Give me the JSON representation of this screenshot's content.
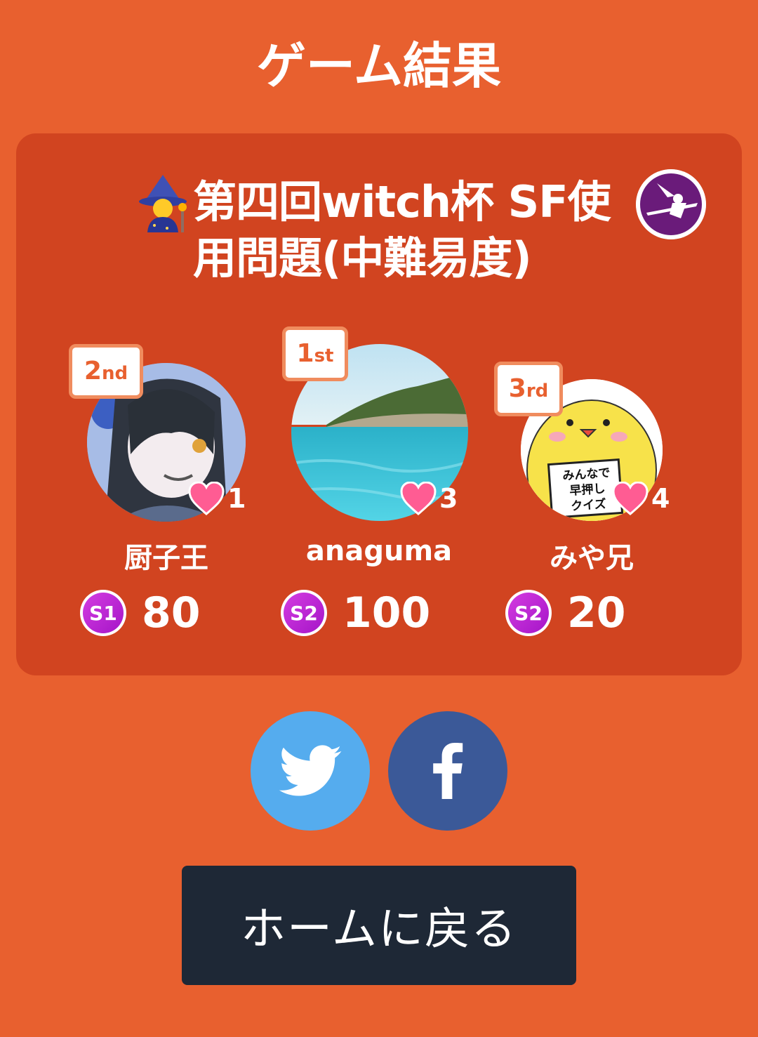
{
  "header": {
    "title": "ゲーム結果"
  },
  "quiz": {
    "emoji_icon": "witch-emoji",
    "title": "第四回witch杯 SF使用問題(中難易度)",
    "owner_avatar_icon": "witch-silhouette-icon"
  },
  "players": [
    {
      "rank_num": "2",
      "rank_suffix": "nd",
      "name": "厨子王",
      "likes": "1",
      "rank_icon": "S1",
      "score": "80"
    },
    {
      "rank_num": "1",
      "rank_suffix": "st",
      "name": "anaguma",
      "likes": "3",
      "rank_icon": "S2",
      "score": "100"
    },
    {
      "rank_num": "3",
      "rank_suffix": "rd",
      "name": "みや兄",
      "likes": "4",
      "rank_icon": "S2",
      "score": "20"
    }
  ],
  "avatar3_sign": [
    "みんなで",
    "早押し",
    "クイズ"
  ],
  "share": {
    "twitter_icon": "twitter-icon",
    "facebook_icon": "facebook-icon"
  },
  "actions": {
    "home_label": "ホームに戻る"
  },
  "colors": {
    "background": "#E8602F",
    "card": "#D14420",
    "badge_border": "#F08C5E",
    "heart": "#FF5C93",
    "twitter": "#55ACEE",
    "facebook": "#3B5998",
    "home_button": "#1E2836"
  }
}
